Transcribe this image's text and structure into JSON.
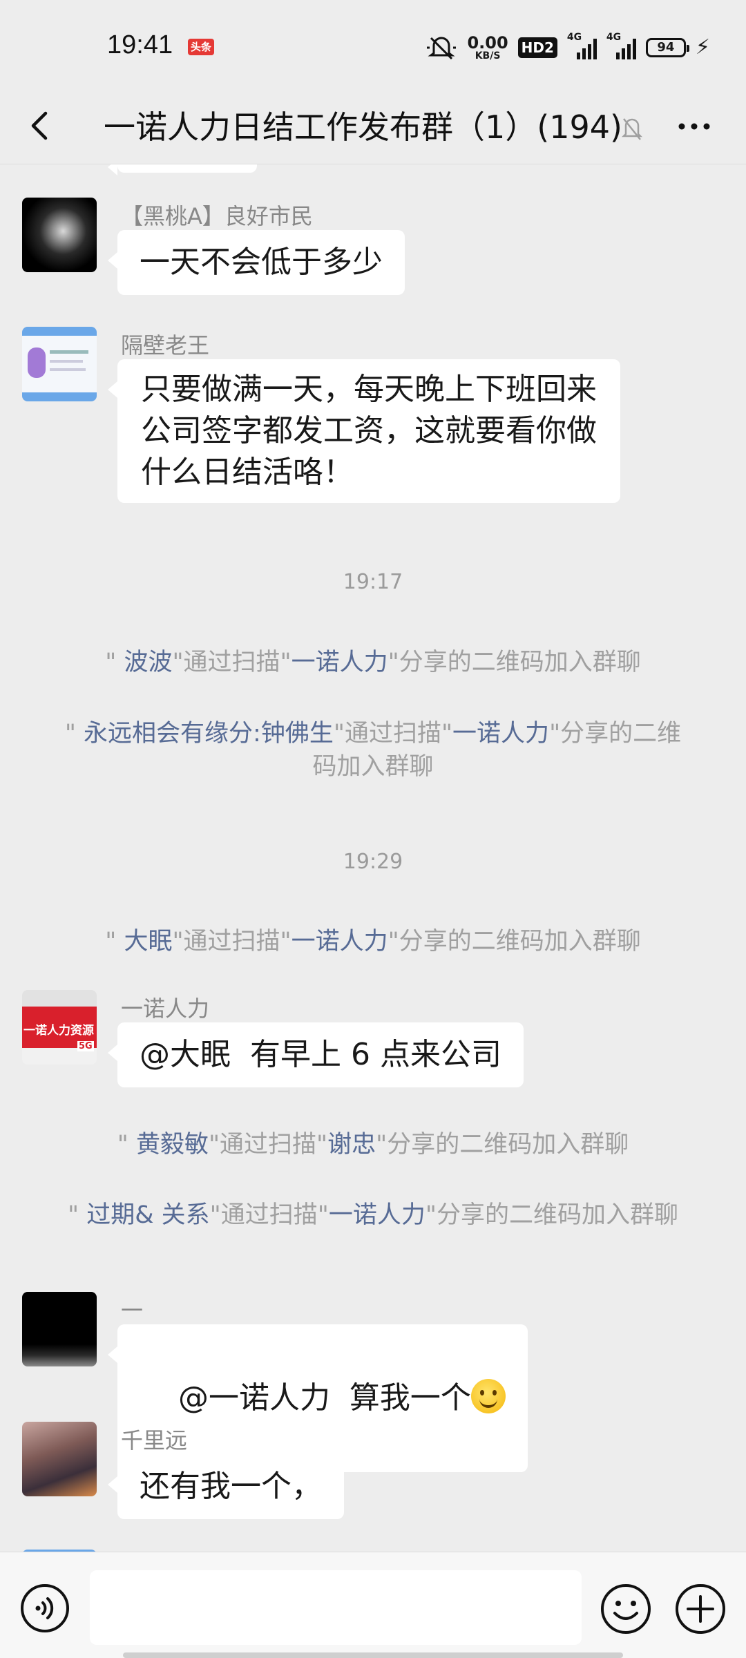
{
  "status_bar": {
    "time": "19:41",
    "app_badge": "头条",
    "net_speed_value": "0.00",
    "net_speed_unit": "KB/S",
    "hd_label": "HD2",
    "signal1_label": "4G",
    "signal2_label": "4G",
    "battery": "94"
  },
  "header": {
    "title": "一诺人力日结工作发布群（1）(194)"
  },
  "messages": [
    {
      "sender": "【黑桃A】良好市民",
      "text": "一天不会低于多少"
    },
    {
      "sender": "隔壁老王",
      "text": "只要做满一天，每天晚上下班回来公司签字都发工资，这就要看你做什么日结活咯！",
      "lines": [
        "只要做满一天，每天晚上下班回来",
        "公司签字都发工资，这就要看你做",
        "什么日结活咯！"
      ]
    },
    {
      "sender": "一诺人力",
      "text": "@大眠  有早上 6 点来公司",
      "avatar_text": "一诺人力资源",
      "avatar_badge": "5G"
    },
    {
      "sender": "一",
      "text": "@一诺人力  算我一个"
    },
    {
      "sender": "千里远",
      "text": "还有我一个，"
    }
  ],
  "times": [
    "19:17",
    "19:29"
  ],
  "system_notices": [
    {
      "q1": "\" ",
      "name": "波波",
      "mid": "\"通过扫描\"",
      "by": "一诺人力",
      "tail": "\"分享的二维码加入群聊"
    },
    {
      "q1": "\" ",
      "name": "永远相会有缘分:钟佛生",
      "mid": "\"通过扫描\"",
      "by": "一诺人力",
      "tail": "\"分享的二维码加入群聊"
    },
    {
      "q1": "\" ",
      "name": "大眠",
      "mid": "\"通过扫描\"",
      "by": "一诺人力",
      "tail": "\"分享的二维码加入群聊"
    },
    {
      "q1": "\" ",
      "name": "黄毅敏",
      "mid": "\"通过扫描\"",
      "by": "谢忠",
      "tail": "\"分享的二维码加入群聊"
    },
    {
      "q1": "\" ",
      "name": "过期& 关系",
      "mid": "\"通过扫描\"",
      "by": "一诺人力",
      "tail": "\"分享的二维码加入群聊"
    }
  ],
  "input": {
    "placeholder": ""
  }
}
